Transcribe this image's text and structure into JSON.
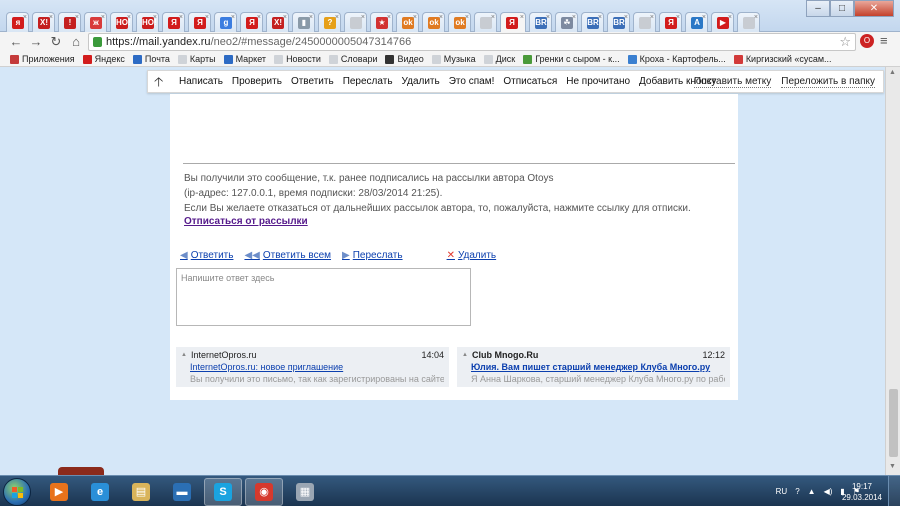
{
  "browser": {
    "tabs": [
      {
        "icon": "yandex-tab-icon",
        "glyph": "я",
        "color": "#d21c1c"
      },
      {
        "icon": "x-tab-icon",
        "glyph": "X!",
        "color": "#c42020"
      },
      {
        "icon": "tab-icon",
        "glyph": "!",
        "color": "#c42020"
      },
      {
        "icon": "tab-icon",
        "glyph": "ж",
        "color": "#d83b3b"
      },
      {
        "icon": "ho-tab-icon",
        "glyph": "HO!",
        "color": "#cc1d1d"
      },
      {
        "icon": "ho-tab-icon",
        "glyph": "HO!",
        "color": "#cc1d1d"
      },
      {
        "icon": "yandex-tab-icon",
        "glyph": "Я",
        "color": "#d21c1c"
      },
      {
        "icon": "yandex-tab-icon",
        "glyph": "Я",
        "color": "#d21c1c"
      },
      {
        "icon": "google-tab-icon",
        "glyph": "g",
        "color": "#3b7de0"
      },
      {
        "icon": "yandex-tab-icon",
        "glyph": "Я",
        "color": "#d21c1c"
      },
      {
        "icon": "x-tab-icon",
        "glyph": "X!",
        "color": "#c42020"
      },
      {
        "icon": "flag-tab-icon",
        "glyph": "▮",
        "color": "#8a9aa8"
      },
      {
        "icon": "question-tab-icon",
        "glyph": "?",
        "color": "#e6a019"
      },
      {
        "icon": "page-tab-icon",
        "glyph": "",
        "color": "#c8ccd2"
      },
      {
        "icon": "star-tab-icon",
        "glyph": "★",
        "color": "#d23232"
      },
      {
        "icon": "ok-tab-icon",
        "glyph": "ok",
        "color": "#e07b22"
      },
      {
        "icon": "ok-tab-icon",
        "glyph": "ok",
        "color": "#e07b22"
      },
      {
        "icon": "ok-tab-icon",
        "glyph": "ok",
        "color": "#e07b22"
      },
      {
        "icon": "page-tab-icon",
        "glyph": "",
        "color": "#c8ccd2"
      },
      {
        "icon": "mail-tab-icon",
        "glyph": "Я",
        "color": "#d21c1c"
      },
      {
        "icon": "br-tab-icon",
        "glyph": "BR",
        "color": "#3c6fb8"
      },
      {
        "icon": "paw-tab-icon",
        "glyph": "☘",
        "color": "#7d8aa0"
      },
      {
        "icon": "br-tab-icon",
        "glyph": "BR",
        "color": "#3c6fb8"
      },
      {
        "icon": "br-tab-icon",
        "glyph": "BR",
        "color": "#3c6fb8"
      },
      {
        "icon": "page-tab-icon",
        "glyph": "",
        "color": "#c8ccd2"
      },
      {
        "icon": "yandex-tab-icon",
        "glyph": "Я",
        "color": "#d21c1c"
      },
      {
        "icon": "dm-tab-icon",
        "glyph": "A",
        "color": "#2b78c6"
      },
      {
        "icon": "youtube-tab-icon",
        "glyph": "▶",
        "color": "#d21c1c"
      },
      {
        "icon": "page-tab-icon",
        "glyph": "",
        "color": "#c8ccd2"
      }
    ],
    "url_host": "https://mail.yandex.ru",
    "url_path": "/neo2/#message/2450000005047314766"
  },
  "bookmarks": [
    {
      "label": "Приложения",
      "color": "#c43a3a"
    },
    {
      "label": "Яндекс",
      "color": "#d21c1c"
    },
    {
      "label": "Почта",
      "color": "#2d6bc4"
    },
    {
      "label": "Карты",
      "color": "#cfd3d8"
    },
    {
      "label": "Маркет",
      "color": "#2d6bc4"
    },
    {
      "label": "Новости",
      "color": "#cfd3d8"
    },
    {
      "label": "Словари",
      "color": "#cfd3d8"
    },
    {
      "label": "Видео",
      "color": "#333333"
    },
    {
      "label": "Музыка",
      "color": "#cfd3d8"
    },
    {
      "label": "Диск",
      "color": "#cfd3d8"
    },
    {
      "label": "Гренки с сыром - к...",
      "color": "#4a9a3a"
    },
    {
      "label": "Кроха - Картофель...",
      "color": "#3a7fd0"
    },
    {
      "label": "Киргизский «сусам...",
      "color": "#d23a3a"
    }
  ],
  "toolbar": {
    "actions": [
      "Написать",
      "Проверить",
      "Ответить",
      "Переслать",
      "Удалить",
      "Это спам!",
      "Отписаться",
      "Не прочитано",
      "Добавить кнопку"
    ],
    "right_actions": [
      "Поставить метку",
      "Переложить в папку"
    ]
  },
  "message": {
    "unsub_line1": "Вы получили это сообщение, т.к. ранее подписались на рассылки автора Otoys",
    "unsub_line2": "(ip-адрес: 127.0.0.1, время подписки: 28/03/2014 21:25).",
    "unsub_line3": "Если Вы желаете отказаться от дальнейших рассылок автора, то, пожалуйста, нажмите ссылку для отписки.",
    "unsub_link": "Отписаться от рассылки"
  },
  "reply": {
    "reply_label": "Ответить",
    "reply_all_label": "Ответить всем",
    "forward_label": "Переслать",
    "delete_label": "Удалить",
    "placeholder": "Напишите ответ здесь"
  },
  "promos": [
    {
      "sender": "InternetOpros.ru",
      "time": "14:04",
      "subject": "InternetOpros.ru: новое приглашение",
      "snippet": "Вы получили это письмо, так как зарегистрированы на сайте I..."
    },
    {
      "sender": "Club Mnogo.Ru",
      "time": "12:12",
      "subject": "Юлия. Вам пишет старший менеджер Клуба Много.ру",
      "snippet": "Я Анна Шаркова, старший менеджер Клуба Много.ру по рабо..."
    }
  ],
  "taskbar": {
    "apps": [
      {
        "name": "media-player-icon",
        "glyph": "▶",
        "color": "#e8731c"
      },
      {
        "name": "ie-icon",
        "glyph": "e",
        "color": "#2a8fd8"
      },
      {
        "name": "explorer-icon",
        "glyph": "▤",
        "color": "#d9b45a"
      },
      {
        "name": "app-icon",
        "glyph": "▬",
        "color": "#2b6fb4"
      },
      {
        "name": "skype-icon",
        "glyph": "S",
        "color": "#1aa3e0"
      },
      {
        "name": "chrome-icon",
        "glyph": "◉",
        "color": "#d6392d"
      },
      {
        "name": "calculator-icon",
        "glyph": "▦",
        "color": "#9aa6b3"
      }
    ],
    "language": "RU",
    "time": "19:17",
    "date": "29.03.2014"
  }
}
